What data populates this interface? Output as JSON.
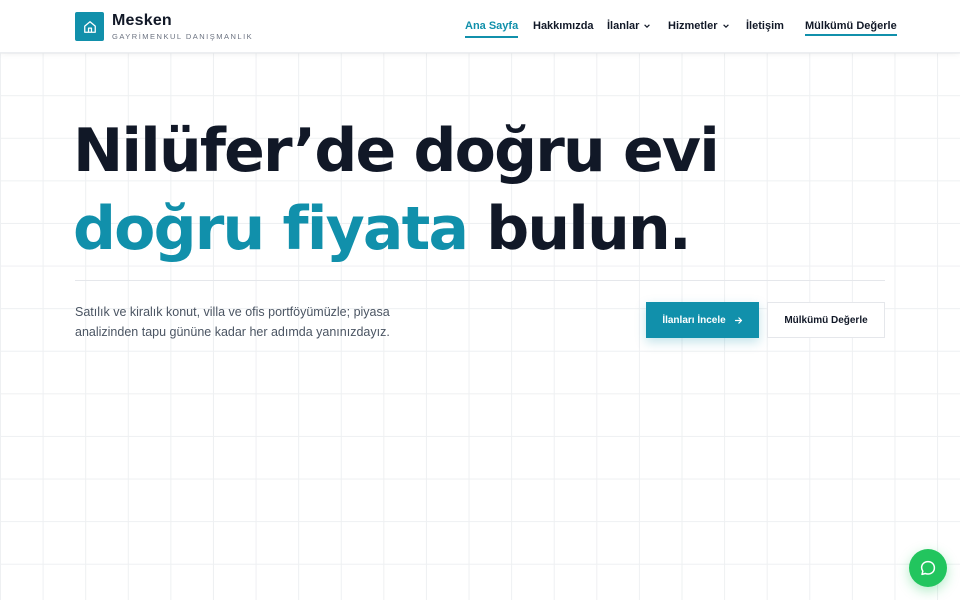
{
  "brand": {
    "name": "Mesken",
    "subtitle": "GAYRİMENKUL DANIŞMANLIK",
    "logo_icon": "home-icon"
  },
  "nav": {
    "items": [
      {
        "label": "Ana Sayfa",
        "active": true
      },
      {
        "label": "Hakkımızda"
      },
      {
        "label": "İlanlar",
        "dropdown": true
      },
      {
        "label": "Hizmetler",
        "dropdown": true
      },
      {
        "label": "İletişim"
      }
    ],
    "cta": "Mülkümü Değerle"
  },
  "hero": {
    "line1": "Nilüfer’de doğru evi",
    "line2_accent": "doğru fiyata",
    "line2_rest": " bulun.",
    "description": "Satılık ve kiralık konut, villa ve ofis portföyümüzle; piyasa analizinden tapu gününe kadar her adımda yanınızdayız.",
    "primary_button": "İlanları İncele",
    "secondary_button": "Mülkümü Değerle"
  },
  "chat": {
    "icon": "chat-bubble-icon"
  },
  "colors": {
    "accent": "#1190ab",
    "text": "#111827",
    "chat": "#22c55e"
  }
}
